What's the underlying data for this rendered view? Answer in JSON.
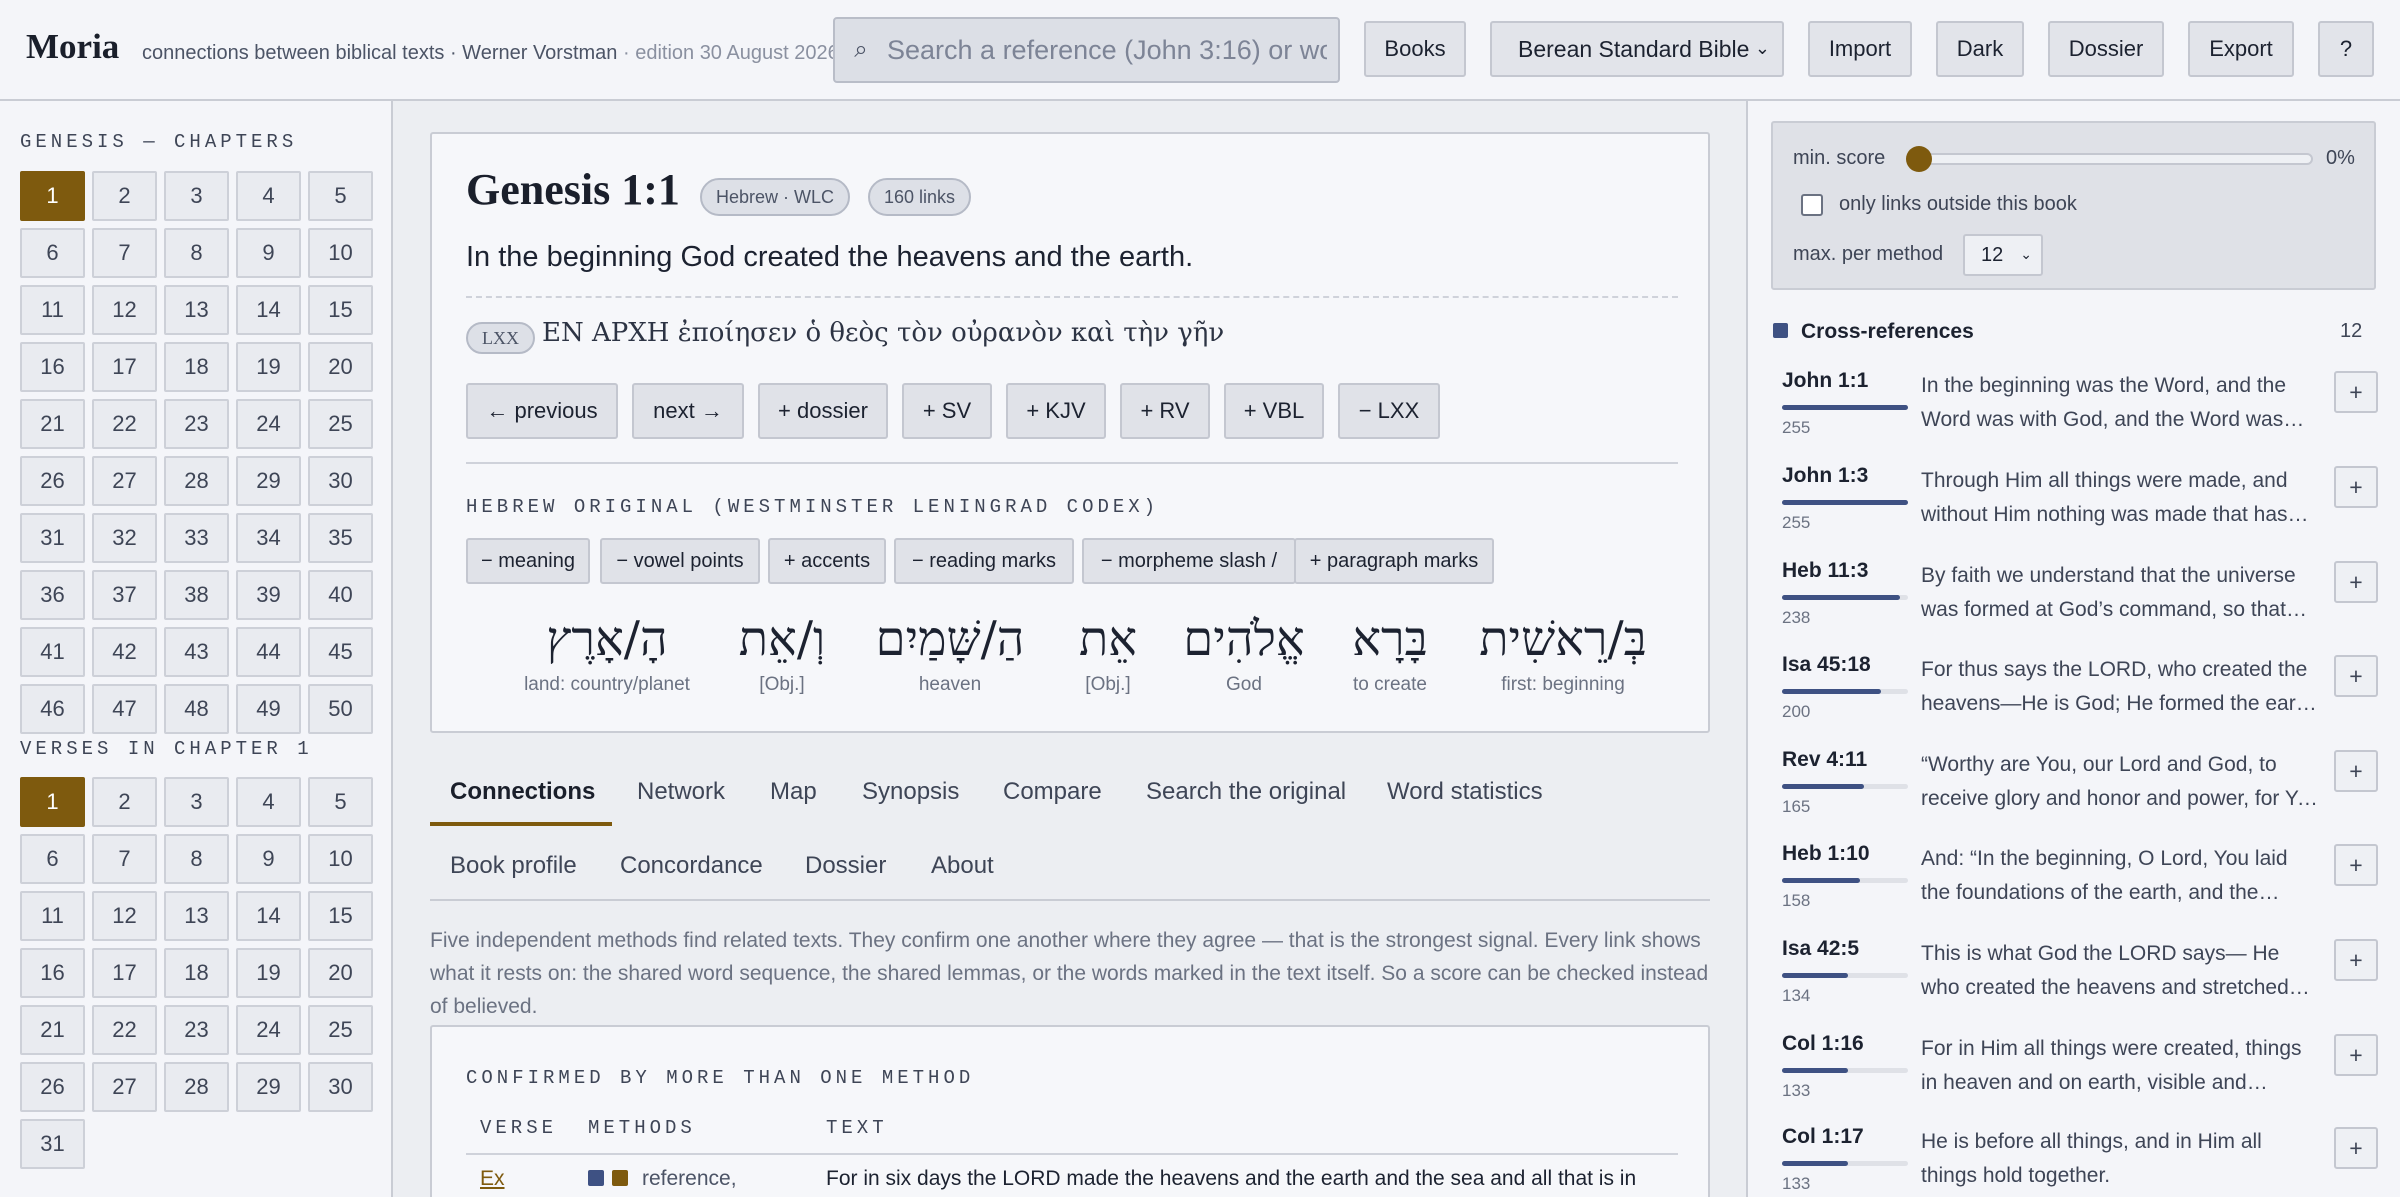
{
  "header": {
    "brand": "Moria",
    "tagline": "connections between biblical texts · Werner Vorstman",
    "edition": " · edition 30 August 2026",
    "search_placeholder": "Search a reference (John 3:16) or word",
    "books_label": "Books",
    "translation_selected": "Berean Standard Bible",
    "import_label": "Import",
    "dark_label": "Dark",
    "dossier_label": "Dossier",
    "export_label": "Export",
    "help_label": "?"
  },
  "sidebar": {
    "chapters_heading": "GENESIS — CHAPTERS",
    "chapters": [
      "1",
      "2",
      "3",
      "4",
      "5",
      "6",
      "7",
      "8",
      "9",
      "10",
      "11",
      "12",
      "13",
      "14",
      "15",
      "16",
      "17",
      "18",
      "19",
      "20",
      "21",
      "22",
      "23",
      "24",
      "25",
      "26",
      "27",
      "28",
      "29",
      "30",
      "31",
      "32",
      "33",
      "34",
      "35",
      "36",
      "37",
      "38",
      "39",
      "40",
      "41",
      "42",
      "43",
      "44",
      "45",
      "46",
      "47",
      "48",
      "49",
      "50"
    ],
    "active_chapter": "1",
    "verses_heading": "VERSES IN CHAPTER 1",
    "verses": [
      "1",
      "2",
      "3",
      "4",
      "5",
      "6",
      "7",
      "8",
      "9",
      "10",
      "11",
      "12",
      "13",
      "14",
      "15",
      "16",
      "17",
      "18",
      "19",
      "20",
      "21",
      "22",
      "23",
      "24",
      "25",
      "26",
      "27",
      "28",
      "29",
      "30",
      "31"
    ],
    "active_verse": "1"
  },
  "verse": {
    "reference": "Genesis 1:1",
    "source_badge": "Hebrew · WLC",
    "links_badge": "160 links",
    "text": "In the beginning God created the heavens and the earth.",
    "lxx_badge": "LXX",
    "lxx_text": "ΕΝ ΑΡΧΗ ἐποίησεν ὁ θεὸς τὸν οὐρανὸν καὶ τὴν γῆν",
    "actions": [
      "← previous",
      "next →",
      "+ dossier",
      "+ SV",
      "+ KJV",
      "+ RV",
      "+ VBL",
      "− LXX"
    ],
    "hebrew_heading": "HEBREW ORIGINAL (WESTMINSTER LENINGRAD CODEX)",
    "toggles": [
      "− meaning",
      "− vowel points",
      "+ accents",
      "− reading marks",
      "− morpheme slash /",
      "+ paragraph marks"
    ],
    "words": [
      {
        "heb": "בְּ/רֵאשִׁית",
        "gloss": "first: beginning"
      },
      {
        "heb": "בָּרָא",
        "gloss": "to create"
      },
      {
        "heb": "אֱלֹהִים",
        "gloss": "God"
      },
      {
        "heb": "אֵת",
        "gloss": "[Obj.]"
      },
      {
        "heb": "הַ/שָּׁמַיִם",
        "gloss": "heaven"
      },
      {
        "heb": "וְ/אֵת",
        "gloss": "[Obj.]"
      },
      {
        "heb": "הָ/אָרֶץ",
        "gloss": "land: country/planet"
      }
    ]
  },
  "tabs": {
    "row1": [
      "Connections",
      "Network",
      "Map",
      "Synopsis",
      "Compare",
      "Search the original",
      "Word statistics"
    ],
    "row2": [
      "Book profile",
      "Concordance",
      "Dossier",
      "About"
    ],
    "active": "Connections"
  },
  "connections": {
    "intro": "Five independent methods find related texts. They confirm one another where they agree — that is the strongest signal. Every link shows what it rests on: the shared word sequence, the shared lemmas, or the words marked in the text itself. So a score can be checked instead of believed.",
    "confirmed_heading": "CONFIRMED BY MORE THAN ONE METHOD",
    "col_verse": "VERSE",
    "col_methods": "METHODS",
    "col_text": "TEXT",
    "first_row": {
      "ref": "Ex",
      "methods": "reference,",
      "method_colors": [
        "#3e5183",
        "#7e5a0e"
      ],
      "text": "For in six days the LORD made the heavens and the earth and the sea and all that is in"
    }
  },
  "filters": {
    "min_score_label": "min. score",
    "min_score_value": "0%",
    "min_score_fraction": 0,
    "outside_label": "only links outside this book",
    "outside_checked": false,
    "max_label": "max. per method",
    "max_value": "12"
  },
  "crossrefs": {
    "heading": "Cross-references",
    "count": "12",
    "max_score": 255,
    "items": [
      {
        "ref": "John 1:1",
        "score": 255,
        "text": "In the beginning was the Word, and the Word was with God, and the Word was God."
      },
      {
        "ref": "John 1:3",
        "score": 255,
        "text": "Through Him all things were made, and without Him nothing was made that has been made."
      },
      {
        "ref": "Heb 11:3",
        "score": 238,
        "text": "By faith we understand that the universe was formed at God’s command, so that what is seen was not made out of what was visible."
      },
      {
        "ref": "Isa 45:18",
        "score": 200,
        "text": "For thus says the LORD, who created the heavens—He is God; He formed the earth and fashioned it"
      },
      {
        "ref": "Rev 4:11",
        "score": 165,
        "text": "“Worthy are You, our Lord and God, to receive glory and honor and power, for You created all things"
      },
      {
        "ref": "Heb 1:10",
        "score": 158,
        "text": "And: “In the beginning, O Lord, You laid the foundations of the earth, and the heavens are the work of Your hands."
      },
      {
        "ref": "Isa 42:5",
        "score": 134,
        "text": "This is what God the LORD says— He who created the heavens and stretched them out"
      },
      {
        "ref": "Col 1:16",
        "score": 133,
        "text": "For in Him all things were created, things in heaven and on earth, visible and invisible"
      },
      {
        "ref": "Col 1:17",
        "score": 133,
        "text": "He is before all things, and in Him all things hold together."
      }
    ],
    "add_label": "+"
  }
}
